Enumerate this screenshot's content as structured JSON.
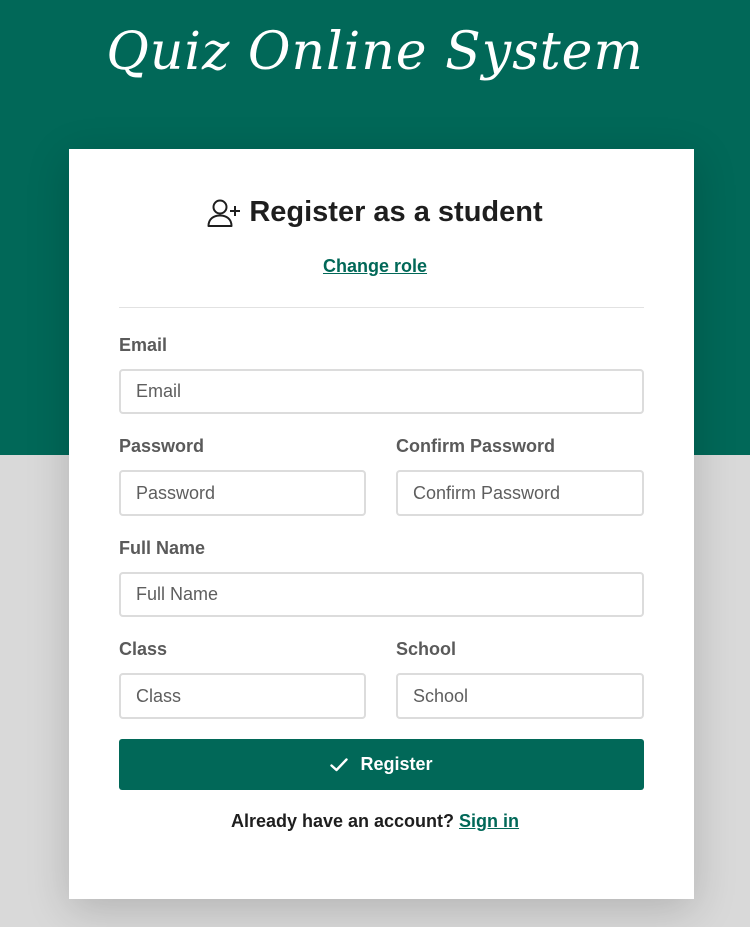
{
  "app": {
    "title": "Quiz Online System"
  },
  "colors": {
    "brand": "#016858",
    "background": "#d9d9d9",
    "card": "#ffffff"
  },
  "card": {
    "icon": "user-plus-icon",
    "title": "Register as a student",
    "change_role_link": "Change role"
  },
  "form": {
    "email": {
      "label": "Email",
      "placeholder": "Email",
      "value": ""
    },
    "password": {
      "label": "Password",
      "placeholder": "Password",
      "value": ""
    },
    "confirm_password": {
      "label": "Confirm Password",
      "placeholder": "Confirm Password",
      "value": ""
    },
    "full_name": {
      "label": "Full Name",
      "placeholder": "Full Name",
      "value": ""
    },
    "class": {
      "label": "Class",
      "placeholder": "Class",
      "value": ""
    },
    "school": {
      "label": "School",
      "placeholder": "School",
      "value": ""
    },
    "submit": {
      "label": "Register",
      "icon": "check-icon"
    }
  },
  "footer": {
    "prompt": "Already have an account?",
    "sign_in_link": "Sign in"
  }
}
